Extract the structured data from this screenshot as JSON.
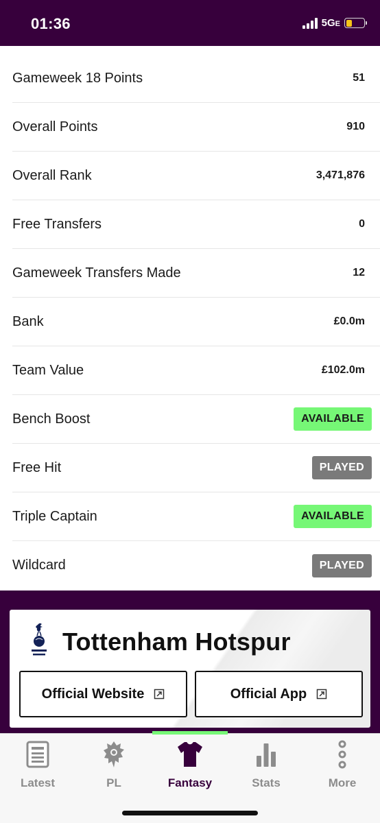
{
  "status_bar": {
    "time": "01:36",
    "network": "5G",
    "network_suffix": "E",
    "signal_icon": "cellular-signal-icon",
    "battery_icon": "battery-low-icon",
    "battery_level": 0.35,
    "battery_color": "#f5c518"
  },
  "stats": [
    {
      "label": "Gameweek 18 Points",
      "value": "51"
    },
    {
      "label": "Overall Points",
      "value": "910"
    },
    {
      "label": "Overall Rank",
      "value": "3,471,876"
    },
    {
      "label": "Free Transfers",
      "value": "0"
    },
    {
      "label": "Gameweek Transfers Made",
      "value": "12"
    },
    {
      "label": "Bank",
      "value": "£0.0m"
    },
    {
      "label": "Team Value",
      "value": "£102.0m"
    }
  ],
  "chips": [
    {
      "label": "Bench Boost",
      "status": "AVAILABLE"
    },
    {
      "label": "Free Hit",
      "status": "PLAYED"
    },
    {
      "label": "Triple Captain",
      "status": "AVAILABLE"
    },
    {
      "label": "Wildcard",
      "status": "PLAYED"
    }
  ],
  "club": {
    "name": "Tottenham Hotspur",
    "crest_icon": "tottenham-crest-icon",
    "website_label": "Official Website",
    "app_label": "Official App",
    "external_icon": "external-link-icon"
  },
  "tabbar": {
    "tabs": [
      {
        "label": "Latest",
        "icon": "news-icon"
      },
      {
        "label": "PL",
        "icon": "premier-league-lion-icon"
      },
      {
        "label": "Fantasy",
        "icon": "jersey-icon"
      },
      {
        "label": "Stats",
        "icon": "bar-chart-icon"
      },
      {
        "label": "More",
        "icon": "more-dots-icon"
      }
    ],
    "active": "Fantasy"
  },
  "colors": {
    "brand_purple": "#37003c",
    "available_green": "#76f776",
    "played_grey": "#7a7a7a"
  }
}
